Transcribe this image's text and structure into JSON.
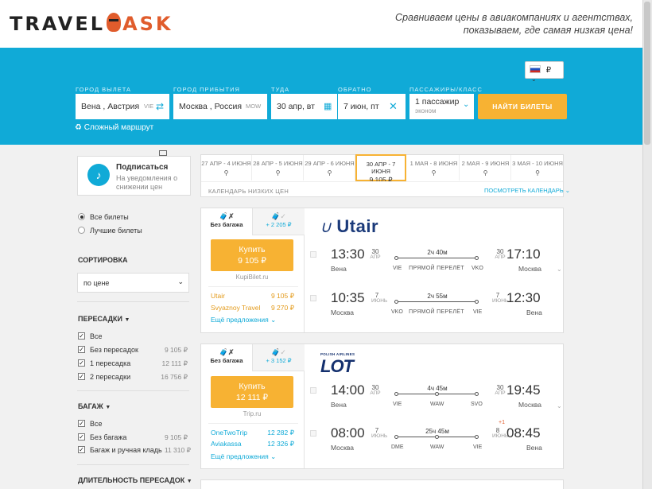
{
  "header": {
    "logo_left": "TRAVEL",
    "logo_right": "ASK",
    "tagline_line1": "Сравниваем цены в авиакомпаниях и агентствах,",
    "tagline_line2": "показываем, где самая низкая цена!"
  },
  "currency": {
    "symbol": "₽",
    "flag": "russia-flag"
  },
  "search": {
    "from_label": "Город вылета",
    "from_value": "Вена , Австрия",
    "from_code": "VIE",
    "to_label": "Город прибытия",
    "to_value": "Москва , Россия",
    "to_code": "MOW",
    "depart_label": "Туда",
    "depart_value": "30 апр, вт",
    "return_label": "Обратно",
    "return_value": "7 июн, пт",
    "pax_label": "Пассажиры/класс",
    "pax_value": "1 пассажир",
    "pax_class": "эконом",
    "button": "НАЙТИ БИЛЕТЫ",
    "complex_route": "Сложный маршрут"
  },
  "sidebar": {
    "subscribe_title": "Подписаться",
    "subscribe_desc": "На уведомления о снижении цен",
    "radio_all": "Все билеты",
    "radio_best": "Лучшие билеты",
    "sort_title": "СОРТИРОВКА",
    "sort_value": "по цене",
    "stops_title": "ПЕРЕСАДКИ",
    "stops": [
      {
        "label": "Все",
        "count": ""
      },
      {
        "label": "Без пересадок",
        "count": "9 105 ₽"
      },
      {
        "label": "1 пересадка",
        "count": "12 111 ₽"
      },
      {
        "label": "2 пересадки",
        "count": "16 756 ₽"
      }
    ],
    "baggage_title": "БАГАЖ",
    "baggage": [
      {
        "label": "Все",
        "count": ""
      },
      {
        "label": "Без багажа",
        "count": "9 105 ₽"
      },
      {
        "label": "Багаж и ручная кладь",
        "count": "11 310 ₽"
      }
    ],
    "layover_title": "ДЛИТЕЛЬНОСТЬ ПЕРЕСАДОК"
  },
  "calendar": {
    "cells": [
      {
        "range": "27 АПР - 4 ИЮНЯ",
        "price": ""
      },
      {
        "range": "28 АПР - 5 ИЮНЯ",
        "price": ""
      },
      {
        "range": "29 АПР - 6 ИЮНЯ",
        "price": ""
      },
      {
        "range": "30 АПР - 7 ИЮНЯ",
        "price": "9 105 ₽"
      },
      {
        "range": "1 МАЯ - 8 ИЮНЯ",
        "price": ""
      },
      {
        "range": "2 МАЯ - 9 ИЮНЯ",
        "price": ""
      },
      {
        "range": "3 МАЯ - 10 ИЮНЯ",
        "price": ""
      }
    ],
    "footer_left": "КАЛЕНДАРЬ НИЗКИХ ЦЕН",
    "footer_right": "ПОСМОТРЕТЬ КАЛЕНДАРЬ"
  },
  "cards": [
    {
      "airline": "Utair",
      "tab_active": "Без багажа",
      "tab_inactive": "+ 2 205 ₽",
      "buy_label": "Купить",
      "buy_price": "9 105 ₽",
      "buy_site": "KupiBilet.ru",
      "agents": [
        {
          "name": "Utair",
          "price": "9 105 ₽"
        },
        {
          "name": "Svyaznoy Travel",
          "price": "9 270 ₽"
        }
      ],
      "more": "Ещё предложения",
      "legs": [
        {
          "dep_time": "13:30",
          "dep_day": "30",
          "dep_month": "АПР",
          "dep_city": "Вена",
          "dep_code": "VIE",
          "duration": "2ч 40м",
          "via": "ПРЯМОЙ ПЕРЕЛЁТ",
          "arr_code": "VKO",
          "arr_day": "30",
          "arr_month": "АПР",
          "arr_time": "17:10",
          "arr_city": "Москва",
          "plus": ""
        },
        {
          "dep_time": "10:35",
          "dep_day": "7",
          "dep_month": "ИЮНЬ",
          "dep_city": "Москва",
          "dep_code": "VKO",
          "duration": "2ч 55м",
          "via": "ПРЯМОЙ ПЕРЕЛЁТ",
          "arr_code": "VIE",
          "arr_day": "7",
          "arr_month": "ИЮНЬ",
          "arr_time": "12:30",
          "arr_city": "Вена",
          "plus": ""
        }
      ]
    },
    {
      "airline": "LOT",
      "airline_sub": "POLISH AIRLINES",
      "tab_active": "Без багажа",
      "tab_inactive": "+ 3 152 ₽",
      "buy_label": "Купить",
      "buy_price": "12 111 ₽",
      "buy_site": "Trip.ru",
      "agents": [
        {
          "name": "OneTwoTrip",
          "price": "12 282 ₽"
        },
        {
          "name": "Aviakassa",
          "price": "12 326 ₽"
        }
      ],
      "more": "Ещё предложения",
      "legs": [
        {
          "dep_time": "14:00",
          "dep_day": "30",
          "dep_month": "АПР",
          "dep_city": "Вена",
          "dep_code": "VIE",
          "duration": "4ч 45м",
          "via": "WAW",
          "arr_code": "SVO",
          "arr_day": "30",
          "arr_month": "АПР",
          "arr_time": "19:45",
          "arr_city": "Москва",
          "plus": ""
        },
        {
          "dep_time": "08:00",
          "dep_day": "7",
          "dep_month": "ИЮНЬ",
          "dep_city": "Москва",
          "dep_code": "DME",
          "duration": "25ч 45м",
          "via": "WAW",
          "arr_code": "VIE",
          "arr_day": "8",
          "arr_month": "ИЮНЬ",
          "arr_time": "08:45",
          "arr_city": "Вена",
          "plus": "+1"
        }
      ]
    }
  ]
}
